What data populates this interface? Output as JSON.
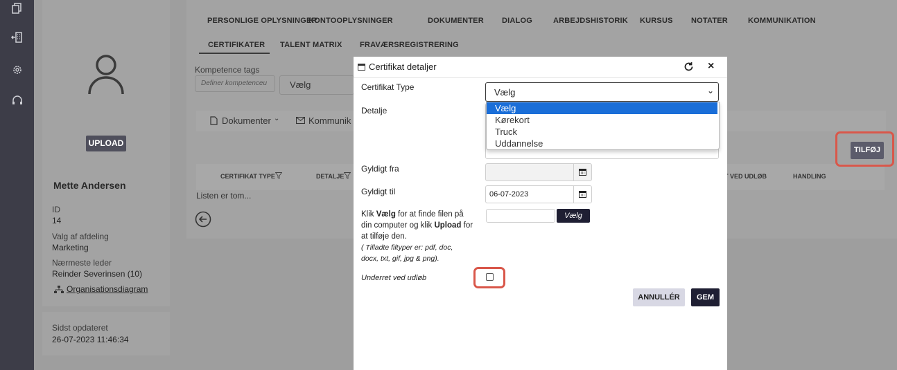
{
  "profile": {
    "upload_label": "UPLOAD",
    "name": "Mette Andersen",
    "id_label": "ID",
    "id_value": "14",
    "dept_label": "Valg af afdeling",
    "dept_value": "Marketing",
    "manager_label": "Nærmeste leder",
    "manager_value": "Reinder Severinsen (10)",
    "org_link": "Organisationsdiagram",
    "updated_label": "Sidst opdateret",
    "updated_value": "26-07-2023 11:46:34"
  },
  "tabs_row1": [
    "PERSONLIGE OPLYSNINGER",
    "KONTOOPLYSNINGER",
    "DOKUMENTER",
    "DIALOG",
    "ARBEJDSHISTORIK",
    "KURSUS",
    "NOTATER",
    "KOMMUNIKATION"
  ],
  "tabs_row2": [
    "CERTIFIKATER",
    "TALENT MATRIX",
    "FRAVÆRSREGISTRERING"
  ],
  "filters": {
    "tags_label": "Kompetence tags",
    "tags_placeholder": "Definer kompetenceu",
    "select_value": "Vælg"
  },
  "toolbar": {
    "documents": "Dokumenter",
    "communication": "Kommunik"
  },
  "add_button": "TILFØJ",
  "table": {
    "columns": [
      "CERTIFIKAT TYPE",
      "DETALJE",
      "T VED UDLØB",
      "HANDLING"
    ],
    "empty": "Listen er tom..."
  },
  "modal": {
    "title": "Certifikat detaljer",
    "type_label": "Certifikat Type",
    "type_value": "Vælg",
    "options": [
      "Vælg",
      "Kørekort",
      "Truck",
      "Uddannelse"
    ],
    "detail_label": "Detalje",
    "valid_from_label": "Gyldigt fra",
    "valid_from_value": "",
    "valid_to_label": "Gyldigt til",
    "valid_to_value": "06-07-2023",
    "upload_help_1": "Klik ",
    "upload_help_b1": "Vælg",
    "upload_help_2": " for at finde filen på din computer og klik ",
    "upload_help_b2": "Upload",
    "upload_help_3": " for at tilføje den.",
    "filetypes": "( Tilladte filtyper er: pdf, doc, docx, txt, gif, jpg & png).",
    "choose_label": "Vælg",
    "notify_label": "Underret ved udløb",
    "cancel_label": "ANNULLÉR",
    "save_label": "GEM"
  },
  "colors": {
    "rail": "#3d3d48",
    "highlight": "#d9574a",
    "save": "#1f1f33",
    "selected_option": "#1a6ed8"
  }
}
